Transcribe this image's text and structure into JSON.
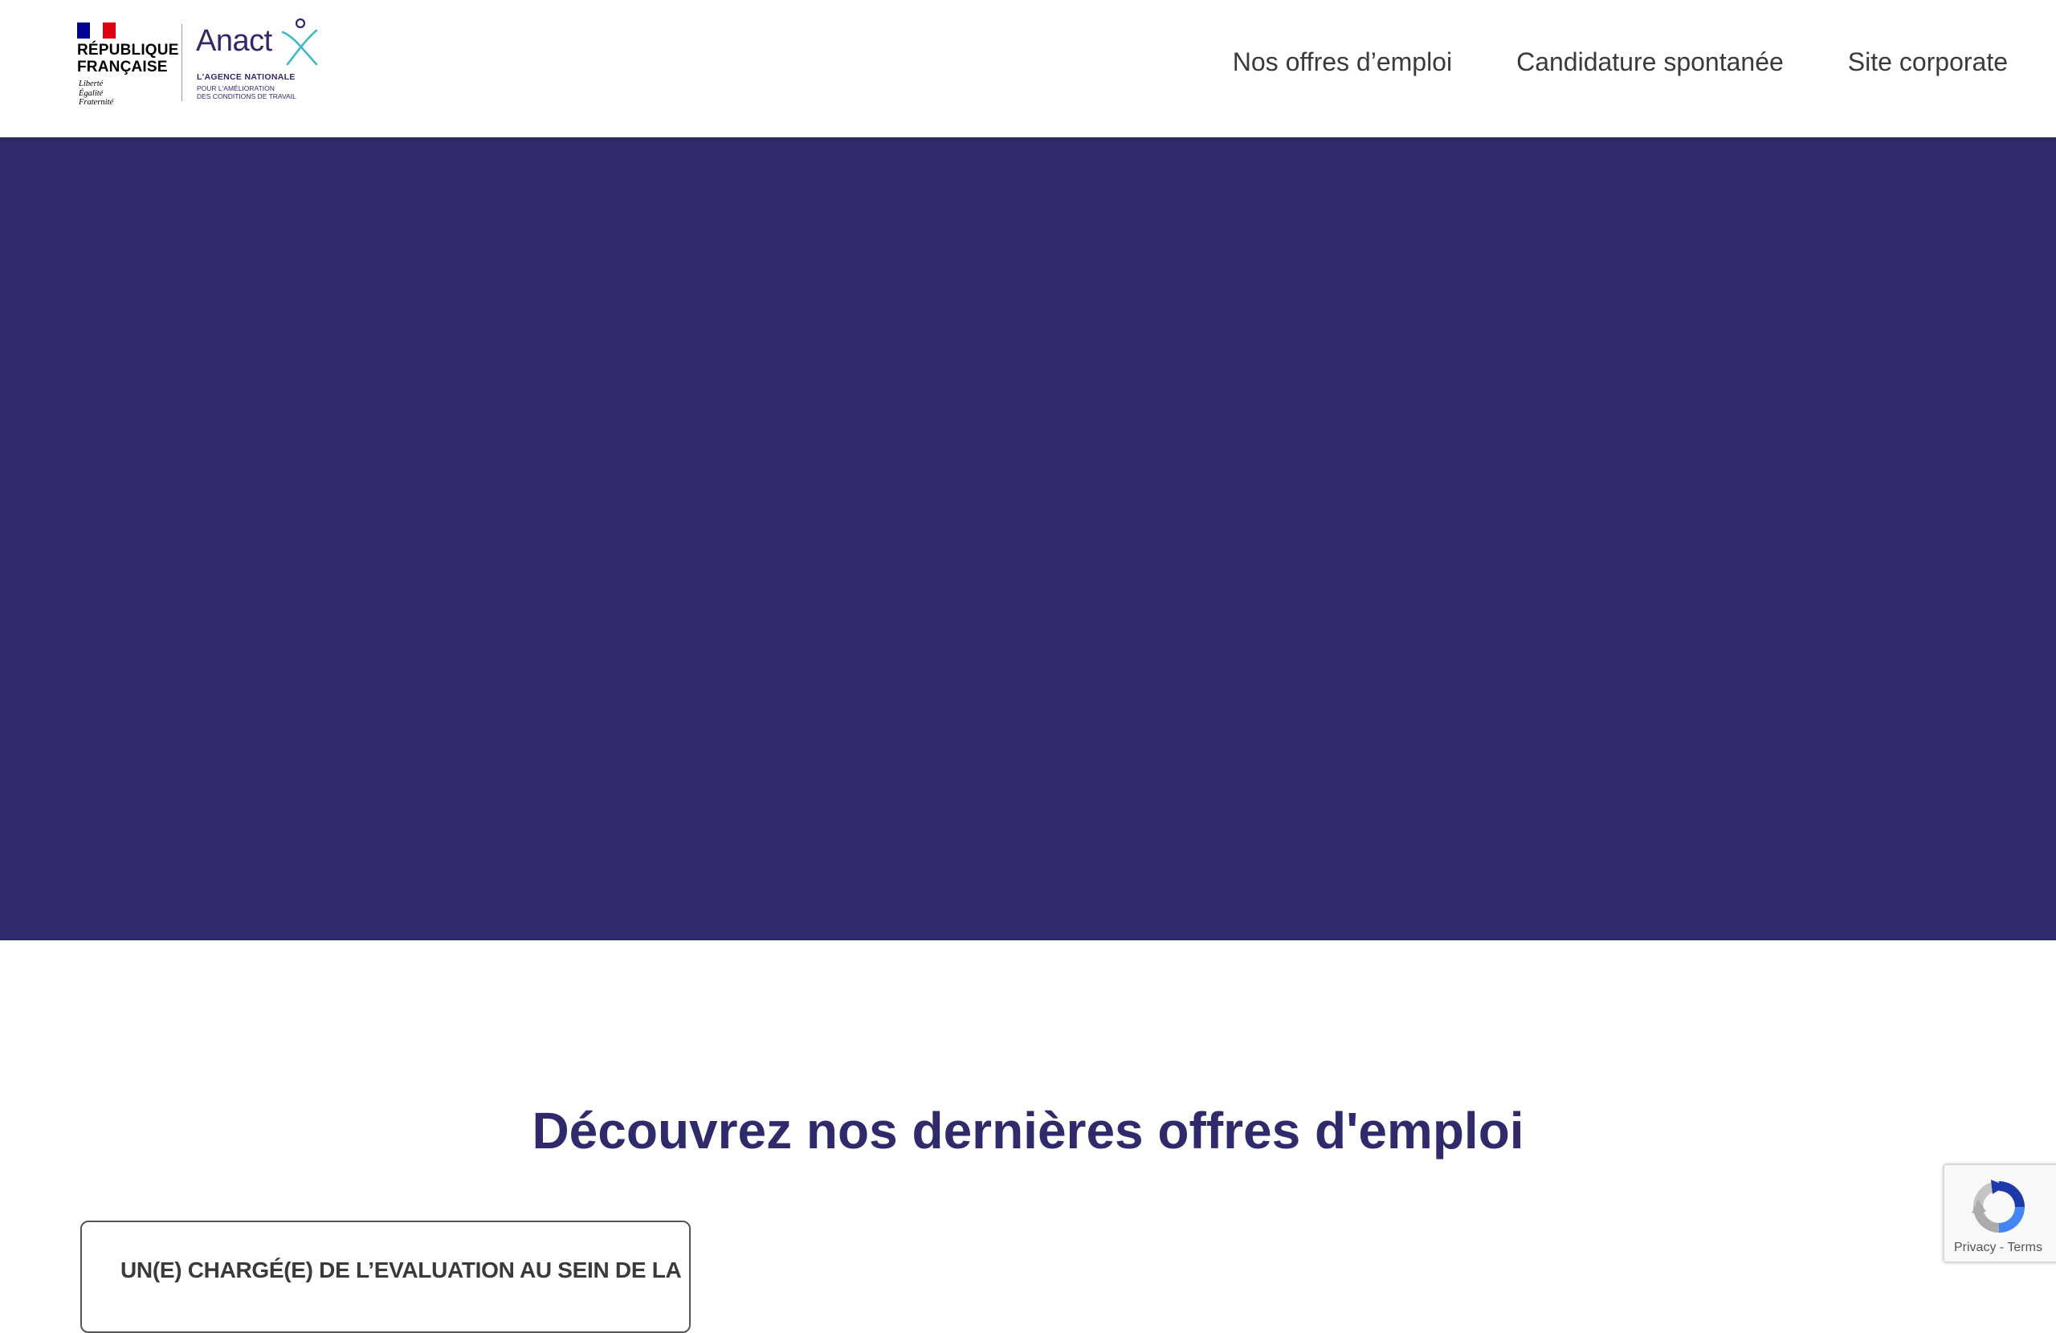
{
  "header": {
    "logo": {
      "rf_title": "RÉPUBLIQUE\nFRANÇAISE",
      "rf_motto": "Liberté\nÉgalité\nFraternité",
      "anact_word": "Anact",
      "anact_tagline": "L'AGENCE NATIONALE",
      "anact_subtitle": "POUR L'AMÉLIORATION\nDES CONDITIONS DE TRAVAIL"
    },
    "nav": [
      {
        "label": "Nos offres d’emploi"
      },
      {
        "label": "Candidature spontanée"
      },
      {
        "label": "Site corporate"
      }
    ]
  },
  "colors": {
    "brand_primary": "#2f2a6b",
    "brand_accent": "#39b7c8",
    "flag_blue": "#000091",
    "flag_red": "#e1000f"
  },
  "main": {
    "section_title": "Découvrez nos dernières offres d'emploi",
    "jobs": [
      {
        "title": "UN(E) CHARGÉ(E) DE L’EVALUATION AU SEIN DE LA"
      }
    ]
  },
  "recaptcha": {
    "privacy": "Privacy",
    "separator": " - ",
    "terms": "Terms",
    "icon": "recaptcha-icon"
  }
}
